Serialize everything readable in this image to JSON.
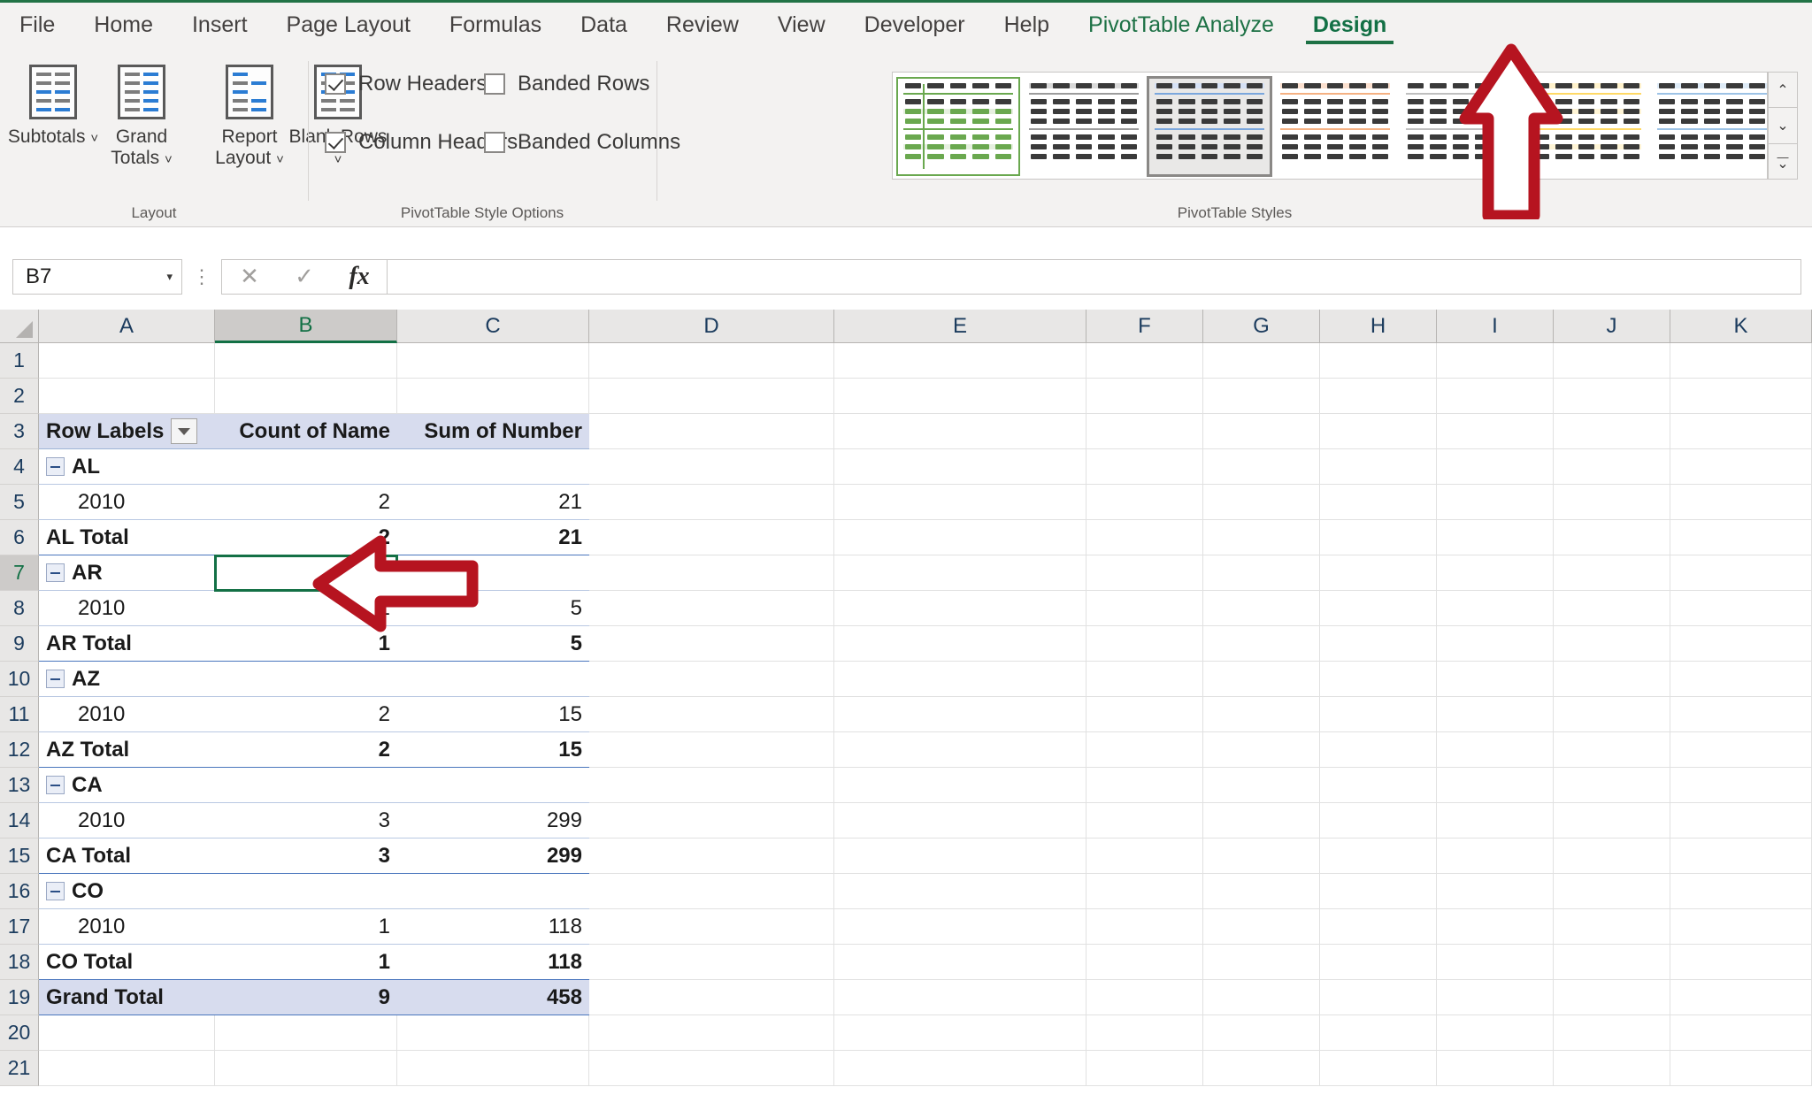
{
  "ribbon": {
    "tabs": [
      {
        "label": "File",
        "kind": "normal"
      },
      {
        "label": "Home",
        "kind": "normal"
      },
      {
        "label": "Insert",
        "kind": "normal"
      },
      {
        "label": "Page Layout",
        "kind": "normal"
      },
      {
        "label": "Formulas",
        "kind": "normal"
      },
      {
        "label": "Data",
        "kind": "normal"
      },
      {
        "label": "Review",
        "kind": "normal"
      },
      {
        "label": "View",
        "kind": "normal"
      },
      {
        "label": "Developer",
        "kind": "normal"
      },
      {
        "label": "Help",
        "kind": "normal"
      },
      {
        "label": "PivotTable Analyze",
        "kind": "contextual"
      },
      {
        "label": "Design",
        "kind": "contextual-active"
      }
    ],
    "groups": {
      "layout": {
        "label": "Layout",
        "buttons": [
          {
            "label": "Subtotals",
            "dropdown": "˅",
            "icon": "subtotals-icon"
          },
          {
            "label": "Grand Totals",
            "dropdown": "˅",
            "icon": "grand-totals-icon"
          },
          {
            "label": "Report Layout",
            "dropdown": "˅",
            "icon": "report-layout-icon"
          },
          {
            "label": "Blank Rows",
            "dropdown": "˅",
            "icon": "blank-rows-icon"
          }
        ]
      },
      "style_options": {
        "label": "PivotTable Style Options",
        "checkboxes": [
          {
            "label": "Row Headers",
            "checked": true
          },
          {
            "label": "Banded Rows",
            "checked": false
          },
          {
            "label": "Column Headers",
            "checked": true
          },
          {
            "label": "Banded Columns",
            "checked": false
          }
        ]
      },
      "styles": {
        "label": "PivotTable Styles",
        "selected_index": 2,
        "thumbnails": [
          {
            "name": "style-green-light",
            "accent": "#6aa84f",
            "band": "#e6f0e0",
            "header": "#ffffff",
            "outlined": true
          },
          {
            "name": "style-gray-medium",
            "accent": "#9c9c9c",
            "band": "#ffffff",
            "header": "#d9d9d9",
            "outlined": false
          },
          {
            "name": "style-blue-light",
            "accent": "#7ba7dd",
            "band": "#ffffff",
            "header": "#d6e1f5",
            "outlined": false
          },
          {
            "name": "style-orange-light",
            "accent": "#f5b183",
            "band": "#ffffff",
            "header": "#fbe0cf",
            "outlined": false
          },
          {
            "name": "style-gray-dashed",
            "accent": "#bfbfbf",
            "band": "#ffffff",
            "header": "#ffffff",
            "outlined": false
          },
          {
            "name": "style-yellow-light",
            "accent": "#ffd966",
            "band": "#fff5d6",
            "header": "#fff2cc",
            "outlined": false
          },
          {
            "name": "style-blue-pale",
            "accent": "#9dc3e6",
            "band": "#ffffff",
            "header": "#deebf7",
            "outlined": false
          }
        ],
        "scroll_buttons": [
          {
            "name": "scroll-up-button",
            "glyph": "⌃"
          },
          {
            "name": "scroll-down-button",
            "glyph": "⌄"
          },
          {
            "name": "more-styles-button",
            "glyph": "⌄"
          }
        ]
      }
    }
  },
  "formula_bar": {
    "name_box_value": "B7",
    "name_box_caret": "▾",
    "cancel_glyph": "✕",
    "enter_glyph": "✓",
    "fx_glyph": "fx",
    "formula_value": ""
  },
  "grid": {
    "columns": [
      "A",
      "B",
      "C",
      "D",
      "E",
      "F",
      "G",
      "H",
      "I",
      "J",
      "K"
    ],
    "selected_column": "B",
    "rows": [
      1,
      2,
      3,
      4,
      5,
      6,
      7,
      8,
      9,
      10,
      11,
      12,
      13,
      14,
      15,
      16,
      17,
      18,
      19,
      20,
      21
    ],
    "selected_row": 7,
    "selected_cell": "B7"
  },
  "pivot_table": {
    "header": {
      "row_labels": "Row Labels",
      "count_of_name": "Count of Name",
      "sum_of_number": "Sum of Number"
    },
    "rows": [
      {
        "row": 4,
        "label": "AL",
        "type": "group",
        "count": "",
        "sum": ""
      },
      {
        "row": 5,
        "label": "2010",
        "type": "item",
        "count": "2",
        "sum": "21"
      },
      {
        "row": 6,
        "label": "AL Total",
        "type": "total",
        "count": "2",
        "sum": "21"
      },
      {
        "row": 7,
        "label": "AR",
        "type": "group",
        "count": "",
        "sum": ""
      },
      {
        "row": 8,
        "label": "2010",
        "type": "item",
        "count": "1",
        "sum": "5"
      },
      {
        "row": 9,
        "label": "AR Total",
        "type": "total",
        "count": "1",
        "sum": "5"
      },
      {
        "row": 10,
        "label": "AZ",
        "type": "group",
        "count": "",
        "sum": ""
      },
      {
        "row": 11,
        "label": "2010",
        "type": "item",
        "count": "2",
        "sum": "15"
      },
      {
        "row": 12,
        "label": "AZ Total",
        "type": "total",
        "count": "2",
        "sum": "15"
      },
      {
        "row": 13,
        "label": "CA",
        "type": "group",
        "count": "",
        "sum": ""
      },
      {
        "row": 14,
        "label": "2010",
        "type": "item",
        "count": "3",
        "sum": "299"
      },
      {
        "row": 15,
        "label": "CA Total",
        "type": "total",
        "count": "3",
        "sum": "299"
      },
      {
        "row": 16,
        "label": "CO",
        "type": "group",
        "count": "",
        "sum": ""
      },
      {
        "row": 17,
        "label": "2010",
        "type": "item",
        "count": "1",
        "sum": "118"
      },
      {
        "row": 18,
        "label": "CO Total",
        "type": "total",
        "count": "1",
        "sum": "118"
      },
      {
        "row": 19,
        "label": "Grand Total",
        "type": "grand",
        "count": "9",
        "sum": "458"
      }
    ]
  },
  "annotations": [
    {
      "name": "arrow-to-design-tab",
      "direction": "up",
      "color": "#b61420"
    },
    {
      "name": "arrow-to-cell-b7",
      "direction": "left",
      "color": "#b61420"
    }
  ]
}
